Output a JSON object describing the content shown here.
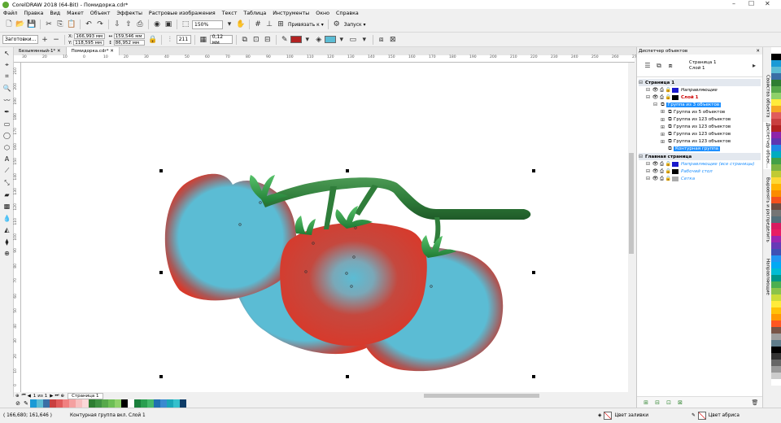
{
  "window": {
    "title": "CorelDRAW 2018 (64-Bit) - Помидорка.cdr*",
    "minimize": "–",
    "maximize": "☐",
    "close": "✕"
  },
  "menu": [
    "Файл",
    "Правка",
    "Вид",
    "Макет",
    "Объект",
    "Эффекты",
    "Растровые изображения",
    "Текст",
    "Таблица",
    "Инструменты",
    "Окно",
    "Справка"
  ],
  "toolbar1": {
    "zoom": "150%",
    "snap_label": "Привязать к",
    "launch_label": "Запуск"
  },
  "toolbar2": {
    "preset": "Заготовки…",
    "x": "166,993 мм",
    "y": "118,595 мм",
    "w": "159,546 мм",
    "h": "86,952 мм",
    "count": "211",
    "outline": "0,12 мм",
    "fill_color": "#b22222",
    "outline_fill": "#5bbcd4"
  },
  "doc_tabs": [
    {
      "label": "Безымянный-1*",
      "active": false
    },
    {
      "label": "Помидорка.cdr*",
      "active": true
    }
  ],
  "ruler": {
    "h_ticks": [
      "30",
      "20",
      "10",
      "0",
      "10",
      "20",
      "30",
      "40",
      "50",
      "60",
      "70",
      "80",
      "90",
      "100",
      "110",
      "120",
      "130",
      "140",
      "150",
      "160",
      "170",
      "180",
      "190",
      "200",
      "210",
      "220",
      "230",
      "240",
      "250",
      "260",
      "270",
      "280"
    ],
    "v_ticks": [
      "210",
      "200",
      "190",
      "180",
      "170",
      "160",
      "150",
      "140",
      "130",
      "120",
      "110",
      "100",
      "90",
      "80",
      "70",
      "60",
      "50",
      "40",
      "30",
      "20",
      "10",
      "0"
    ]
  },
  "pagenav": {
    "current": "1",
    "of_label": "из",
    "total": "1",
    "page_tab": "Страница 1"
  },
  "status": {
    "coords": "( 166,680; 161,646 )",
    "info": "Контурная группа вкл. Слой 1",
    "fill_label": "Цвет заливки",
    "outline_label": "Цвет абриса"
  },
  "docker": {
    "title": "Диспетчер объектов",
    "header_page": "Страница 1",
    "header_layer": "Слой 1",
    "tree": [
      {
        "label": "Страница 1",
        "level": 0,
        "type": "section"
      },
      {
        "label": "Направляющие",
        "level": 1,
        "type": "layer",
        "italic": true,
        "color": "#1a1acc"
      },
      {
        "label": "Слой 1",
        "level": 1,
        "type": "layer",
        "bold": true,
        "textcolor": "#cc0000",
        "color": "#000000"
      },
      {
        "label": "Группа из 3 объектов",
        "level": 2,
        "type": "selected"
      },
      {
        "label": "Группа из 5 объектов",
        "level": 3,
        "type": "group"
      },
      {
        "label": "Группа из 123 объектов",
        "level": 3,
        "type": "group"
      },
      {
        "label": "Группа из 123 объектов",
        "level": 3,
        "type": "group"
      },
      {
        "label": "Группа из 123 объектов",
        "level": 3,
        "type": "group"
      },
      {
        "label": "Группа из 123 объектов",
        "level": 3,
        "type": "group"
      },
      {
        "label": "Контурная группа",
        "level": 3,
        "type": "selected-leaf"
      },
      {
        "label": "Главная страница",
        "level": 0,
        "type": "section"
      },
      {
        "label": "Направляющие (все страницы)",
        "level": 1,
        "type": "layer",
        "italic": true,
        "textcolor": "#1e90ff",
        "color": "#1a1acc"
      },
      {
        "label": "Рабочий стол",
        "level": 1,
        "type": "layer",
        "italic": true,
        "textcolor": "#1e90ff",
        "color": "#000000"
      },
      {
        "label": "Сетка",
        "level": 1,
        "type": "layer",
        "italic": true,
        "textcolor": "#1e90ff",
        "color": "#aaaaaa"
      }
    ]
  },
  "side_tabs": [
    "Свойства объекта",
    "Диспетчер объек…",
    "Выровнять и распределить",
    "Направляющие"
  ],
  "palette": [
    "#1a9ad6",
    "#5bbcd4",
    "#3a6ea5",
    "#c94040",
    "#e05b5b",
    "#f08080",
    "#f4a0a0",
    "#f7c0c0",
    "#fbd8d8",
    "#2e7d32",
    "#3f9142",
    "#56a84a",
    "#6dbe55",
    "#8fd16a",
    "#000000",
    "#ffffff",
    "#1a7f3c",
    "#2a9e50",
    "#44b86a",
    "#1f6fb0",
    "#3a8ad0",
    "#1ba6b8",
    "#35c0cc",
    "#0d3b66"
  ],
  "right_palette": [
    "#ffffff",
    "#000000",
    "#1a9ad6",
    "#5bbcd4",
    "#3a6ea5",
    "#2e7d32",
    "#56a84a",
    "#8fd16a",
    "#ffeb3b",
    "#f5a623",
    "#e05b5b",
    "#c94040",
    "#b22222",
    "#8e24aa",
    "#5e35b1",
    "#1e88e5",
    "#00acc1",
    "#43a047",
    "#7cb342",
    "#c0ca33",
    "#fdd835",
    "#ffb300",
    "#fb8c00",
    "#f4511e",
    "#6d4c41",
    "#757575",
    "#546e7a",
    "#d81b60",
    "#e91e63",
    "#9c27b0",
    "#673ab7",
    "#3f51b5",
    "#2196f3",
    "#03a9f4",
    "#00bcd4",
    "#009688",
    "#4caf50",
    "#8bc34a",
    "#cddc39",
    "#ffeb3b",
    "#ffc107",
    "#ff9800",
    "#ff5722",
    "#795548",
    "#9e9e9e",
    "#607d8b",
    "#000000",
    "#333333",
    "#666666",
    "#999999",
    "#cccccc",
    "#ffffff"
  ],
  "colors": {
    "tomato_red": "#d73a2c",
    "tomato_blue": "#5bbcd4",
    "stem_green": "#2f7d3a",
    "selection": "#1e90ff"
  }
}
